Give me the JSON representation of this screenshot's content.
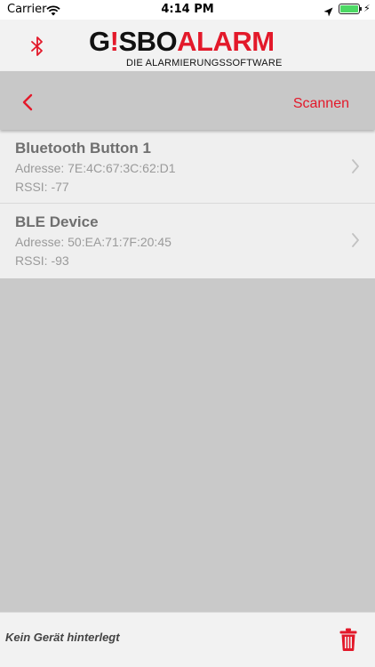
{
  "status_bar": {
    "carrier": "Carrier",
    "time": "4:14 PM",
    "battery_level": 1.0
  },
  "header": {
    "logo_text_dark": "G",
    "logo_text_exclaim": "!",
    "logo_text_dark2": "SBO",
    "logo_text_red": "ALARM",
    "logo_subtitle": "DIE ALARMIERUNGSSOFTWARE"
  },
  "nav": {
    "scan_label": "Scannen"
  },
  "devices": [
    {
      "name": "Bluetooth Button 1",
      "address": "Adresse: 7E:4C:67:3C:62:D1",
      "rssi": "RSSI: -77"
    },
    {
      "name": "BLE Device",
      "address": "Adresse: 50:EA:71:7F:20:45",
      "rssi": "RSSI: -93"
    }
  ],
  "footer": {
    "status": "Kein Gerät hinterlegt"
  },
  "colors": {
    "accent": "#e3192a",
    "nav_bg": "#c8c8c8",
    "list_bg": "#efefef"
  },
  "icons": {
    "bluetooth": "bluetooth-icon",
    "back": "chevron-left-icon",
    "row_disclosure": "chevron-right-icon",
    "delete": "trash-icon"
  }
}
